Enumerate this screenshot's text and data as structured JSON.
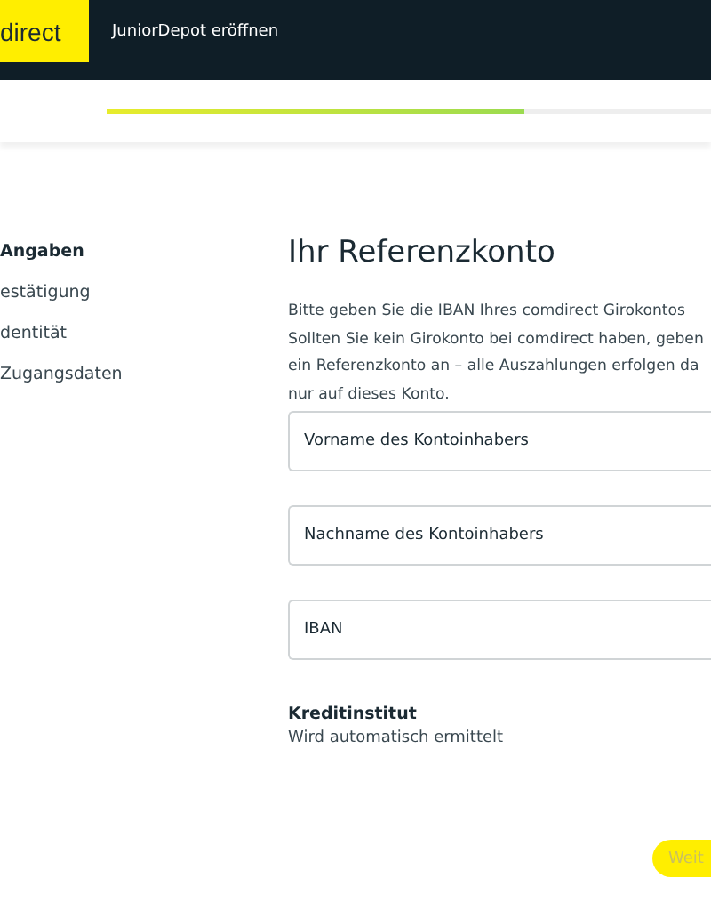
{
  "header": {
    "logo": "direct",
    "title": "JuniorDepot eröffnen"
  },
  "progress": {
    "level": 0.69
  },
  "steps": [
    {
      "label": "Angaben",
      "selected": true
    },
    {
      "label": "estätigung",
      "selected": false
    },
    {
      "label": "dentität",
      "selected": false
    },
    {
      "label": "Zugangsdaten",
      "selected": false
    }
  ],
  "form": {
    "heading": "Ihr Referenzkonto",
    "intro_lines": [
      "Bitte geben Sie die IBAN Ihres comdirect Girokontos",
      "Sollten Sie kein Girokonto bei comdirect haben, geben",
      "ein Referenzkonto an – alle Auszahlungen erfolgen da",
      "nur auf dieses Konto."
    ],
    "fields": [
      {
        "placeholder": "Vorname des Kontoinhabers"
      },
      {
        "placeholder": "Nachname des Kontoinhabers"
      },
      {
        "placeholder": "IBAN"
      }
    ],
    "bank": {
      "label": "Kreditinstitut",
      "value": "Wird automatisch ermittelt"
    },
    "next_button": {
      "label": "Weit",
      "disabled": true
    }
  }
}
